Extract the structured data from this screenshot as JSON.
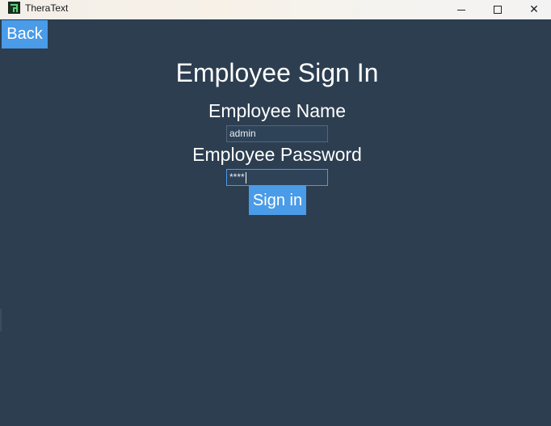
{
  "window": {
    "title": "TheraText",
    "icon": "theratext-app-icon",
    "controls": {
      "minimize": "minimize-icon",
      "maximize": "maximize-icon",
      "close": "close-icon",
      "close_glyph": "✕"
    }
  },
  "nav": {
    "back_label": "Back"
  },
  "form": {
    "title": "Employee Sign In",
    "name_label": "Employee Name",
    "name_value": "admin",
    "password_label": "Employee Password",
    "password_value": "****",
    "submit_label": "Sign in"
  },
  "colors": {
    "background": "#2c3e50",
    "accent": "#4a9be8",
    "text": "#ffffff"
  }
}
